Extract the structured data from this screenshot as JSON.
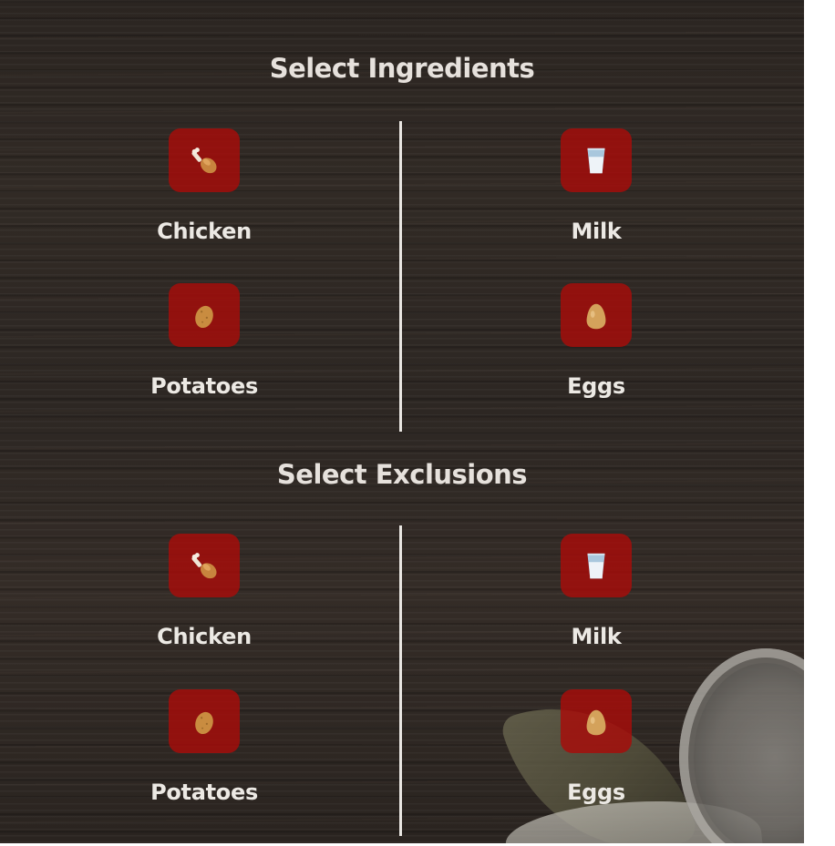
{
  "ingredients": {
    "title": "Select Ingredients",
    "items": [
      {
        "label": "Chicken",
        "icon": "chicken-drumstick-icon"
      },
      {
        "label": "Milk",
        "icon": "milk-glass-icon"
      },
      {
        "label": "Potatoes",
        "icon": "potato-icon"
      },
      {
        "label": "Eggs",
        "icon": "egg-icon"
      }
    ]
  },
  "exclusions": {
    "title": "Select Exclusions",
    "items": [
      {
        "label": "Chicken",
        "icon": "chicken-drumstick-icon"
      },
      {
        "label": "Milk",
        "icon": "milk-glass-icon"
      },
      {
        "label": "Potatoes",
        "icon": "potato-icon"
      },
      {
        "label": "Eggs",
        "icon": "egg-icon"
      }
    ]
  },
  "colors": {
    "tile_red": "#a80c0a",
    "text": "#ece9e4",
    "background_wood": "#2d2723"
  }
}
